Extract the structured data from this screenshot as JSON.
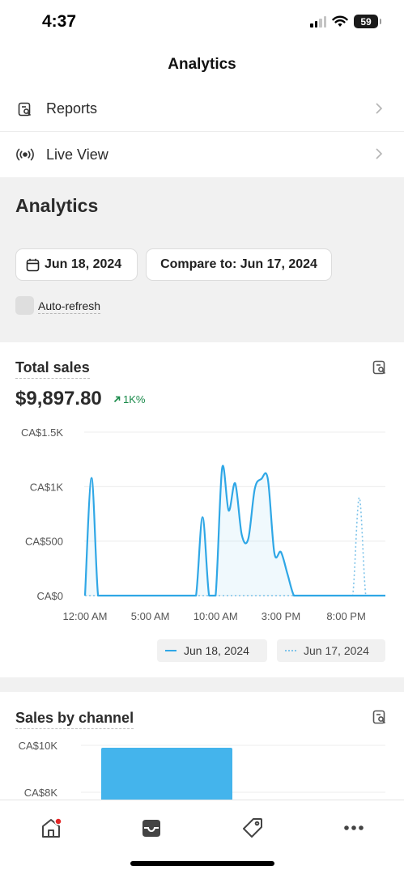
{
  "status_bar": {
    "time": "4:37",
    "battery": "59"
  },
  "nav": {
    "title": "Analytics"
  },
  "menu": [
    {
      "label": "Reports",
      "icon": "report-search-icon"
    },
    {
      "label": "Live View",
      "icon": "broadcast-icon"
    }
  ],
  "analytics": {
    "title": "Analytics",
    "date_button": "Jun 18, 2024",
    "compare_button": "Compare to: Jun 17, 2024",
    "auto_refresh_label": "Auto-refresh",
    "auto_refresh_checked": false
  },
  "total_sales": {
    "title": "Total sales",
    "value": "$9,897.80",
    "delta": "1K%",
    "delta_color": "#1a8a4a",
    "legend": {
      "current": "Jun 18, 2024",
      "compare": "Jun 17, 2024"
    }
  },
  "sales_by_channel": {
    "title": "Sales by channel"
  },
  "tab_bar": {
    "items": [
      "home-icon",
      "inbox-icon",
      "tag-icon",
      "more-icon"
    ],
    "badge_color": "#e32626"
  },
  "colors": {
    "accent": "#2fa7e6",
    "bar": "#44b4ec",
    "compare": "#7fc4ea"
  },
  "chart_data": [
    {
      "type": "area",
      "title": "Total sales",
      "x_ticks": [
        "12:00 AM",
        "5:00 AM",
        "10:00 AM",
        "3:00 PM",
        "8:00 PM"
      ],
      "y_ticks": [
        "CA$0",
        "CA$500",
        "CA$1K",
        "CA$1.5K"
      ],
      "ylim": [
        0,
        1500
      ],
      "x_hours": [
        0,
        0.5,
        1,
        1.5,
        2,
        2.5,
        3,
        3.5,
        4,
        4.5,
        5,
        5.5,
        6,
        6.5,
        7,
        7.5,
        8,
        8.5,
        9,
        9.5,
        10,
        10.5,
        11,
        11.5,
        12,
        12.5,
        13,
        13.5,
        14,
        14.5,
        15,
        15.5,
        16,
        16.5,
        17,
        17.5,
        18,
        18.5,
        19,
        19.5,
        20,
        20.5,
        21,
        21.5,
        22,
        22.5,
        23
      ],
      "series": [
        {
          "name": "Jun 18, 2024",
          "style": "solid",
          "values": [
            0,
            1080,
            0,
            0,
            0,
            0,
            0,
            0,
            0,
            0,
            0,
            0,
            0,
            0,
            0,
            0,
            0,
            0,
            720,
            0,
            0,
            1170,
            780,
            1030,
            560,
            520,
            980,
            1070,
            1070,
            390,
            400,
            200,
            0,
            0,
            0,
            0,
            0,
            0,
            0,
            0,
            0,
            0,
            0,
            0,
            0,
            0,
            0
          ]
        },
        {
          "name": "Jun 17, 2024",
          "style": "dotted",
          "values": [
            0,
            0,
            0,
            0,
            0,
            0,
            0,
            0,
            0,
            0,
            0,
            0,
            0,
            0,
            0,
            0,
            0,
            0,
            0,
            0,
            0,
            0,
            0,
            0,
            0,
            0,
            0,
            0,
            0,
            0,
            0,
            0,
            0,
            0,
            0,
            0,
            0,
            0,
            0,
            0,
            0,
            0,
            900,
            0,
            0,
            0,
            0
          ]
        }
      ],
      "grid": true
    },
    {
      "type": "bar",
      "title": "Sales by channel",
      "y_ticks": [
        "CA$8K",
        "CA$10K"
      ],
      "values": [
        9897.8
      ]
    }
  ]
}
